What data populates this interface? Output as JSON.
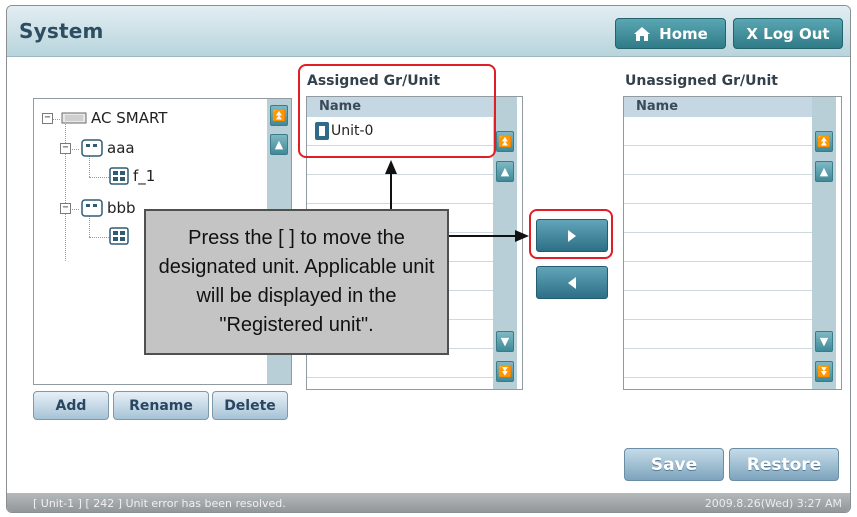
{
  "window": {
    "title": "System"
  },
  "header": {
    "home_label": "Home",
    "logout_label": "X Log Out"
  },
  "tree": {
    "root": "AC SMART",
    "groups": [
      {
        "label": "aaa",
        "children": [
          "f_1"
        ]
      },
      {
        "label": "bbb",
        "children": [
          ""
        ]
      }
    ]
  },
  "tree_buttons": {
    "add": "Add",
    "rename": "Rename",
    "delete": "Delete"
  },
  "assigned": {
    "label": "Assigned Gr/Unit",
    "column": "Name",
    "rows": [
      "Unit-0"
    ]
  },
  "unassigned": {
    "label": "Unassigned Gr/Unit",
    "column": "Name",
    "rows": []
  },
  "footer_buttons": {
    "save": "Save",
    "restore": "Restore"
  },
  "callout": {
    "text": "Press the [ ] to move the designated unit. Applicable unit will be displayed in the \"Registered unit\"."
  },
  "status": {
    "message": "[ Unit-1 ] [ 242 ] Unit error has been resolved.",
    "datetime": "2009.8.26(Wed)  3:27 AM"
  }
}
